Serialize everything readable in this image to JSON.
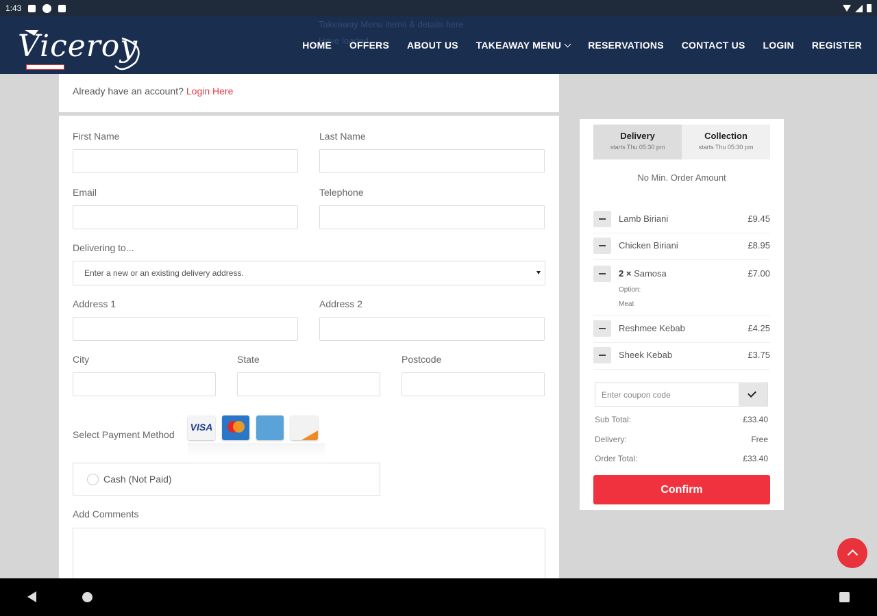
{
  "statusbar": {
    "time": "1:43"
  },
  "header": {
    "logo_text": "Viceroy",
    "ghost_text_1": "Takeaway Menu items & details here",
    "ghost_text_2": "Have loaded",
    "nav": [
      {
        "label": "HOME"
      },
      {
        "label": "OFFERS"
      },
      {
        "label": "ABOUT US"
      },
      {
        "label": "TAKEAWAY MENU"
      },
      {
        "label": "RESERVATIONS"
      },
      {
        "label": "CONTACT US"
      },
      {
        "label": "LOGIN"
      },
      {
        "label": "REGISTER"
      }
    ]
  },
  "login": {
    "prompt": "Already have an account?",
    "link": "Login Here"
  },
  "form": {
    "first_name": "First Name",
    "last_name": "Last Name",
    "email": "Email",
    "telephone": "Telephone",
    "delivering_to": "Delivering to...",
    "address_select": "Enter a new or an existing delivery address.",
    "address1": "Address 1",
    "address2": "Address 2",
    "city": "City",
    "state": "State",
    "postcode": "Postcode",
    "payment_label": "Select Payment Method",
    "cards": [
      "VISA",
      "MasterCard",
      "AMERICAN EXPRESS",
      "DISCOVER"
    ],
    "cash_option": "Cash (Not Paid)",
    "comments": "Add Comments"
  },
  "cart": {
    "tabs": [
      {
        "label": "Delivery",
        "sub": "starts Thu 05:30 pm"
      },
      {
        "label": "Collection",
        "sub": "starts Thu 05:30 pm"
      }
    ],
    "min_order": "No Min. Order Amount",
    "items": [
      {
        "qty": "",
        "name": "Lamb Biriani",
        "price": "£9.45"
      },
      {
        "qty": "",
        "name": "Chicken Biriani",
        "price": "£8.95"
      },
      {
        "qty": "2 ×",
        "name": "Samosa",
        "price": "£7.00",
        "option": "Option:",
        "option_value": "Meat"
      },
      {
        "qty": "",
        "name": "Reshmee Kebab",
        "price": "£4.25"
      },
      {
        "qty": "",
        "name": "Sheek Kebab",
        "price": "£3.75"
      }
    ],
    "coupon_placeholder": "Enter coupon code",
    "sub_total_label": "Sub Total:",
    "sub_total": "£33.40",
    "delivery_label": "Delivery:",
    "delivery_value": "Free",
    "order_total_label": "Order Total:",
    "order_total": "£33.40",
    "confirm": "Confirm"
  }
}
